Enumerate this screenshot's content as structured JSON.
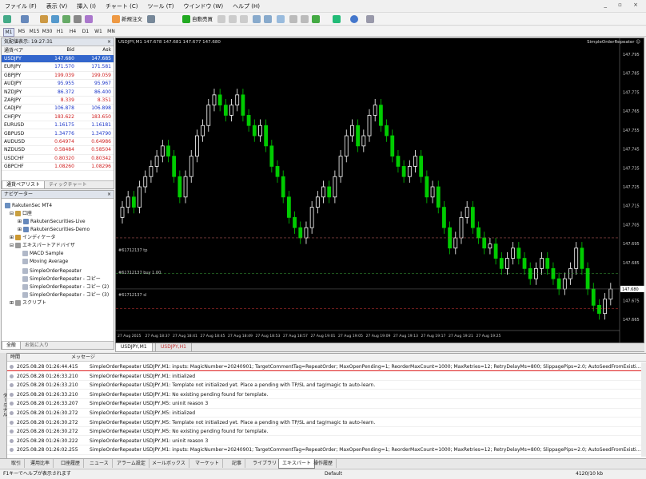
{
  "menu": [
    "ファイル (F)",
    "表示 (V)",
    "挿入 (I)",
    "チャート (C)",
    "ツール (T)",
    "ウインドウ (W)",
    "ヘルプ (H)"
  ],
  "toolbar": {
    "new_order": "新規注文",
    "auto_trade": "自動売買"
  },
  "timeframes": [
    "M1",
    "M5",
    "M15",
    "M30",
    "H1",
    "H4",
    "D1",
    "W1",
    "MN"
  ],
  "market_watch": {
    "title": "気配値表示: 19:27:31",
    "cols": {
      "pair": "通貨ペア",
      "bid": "Bid",
      "ask": "Ask"
    },
    "rows": [
      {
        "pair": "USDJPY",
        "bid": "147.680",
        "ask": "147.685",
        "dir": "sel"
      },
      {
        "pair": "EURJPY",
        "bid": "171.570",
        "ask": "171.581",
        "dir": "up"
      },
      {
        "pair": "GBPJPY",
        "bid": "199.039",
        "ask": "199.059",
        "dir": "dn"
      },
      {
        "pair": "AUDJPY",
        "bid": "95.955",
        "ask": "95.967",
        "dir": "up"
      },
      {
        "pair": "NZDJPY",
        "bid": "86.372",
        "ask": "86.400",
        "dir": "up"
      },
      {
        "pair": "ZARJPY",
        "bid": "8.339",
        "ask": "8.351",
        "dir": "dn"
      },
      {
        "pair": "CADJPY",
        "bid": "106.878",
        "ask": "106.898",
        "dir": "up"
      },
      {
        "pair": "CHFJPY",
        "bid": "183.622",
        "ask": "183.650",
        "dir": "dn"
      },
      {
        "pair": "EURUSD",
        "bid": "1.16175",
        "ask": "1.16181",
        "dir": "up"
      },
      {
        "pair": "GBPUSD",
        "bid": "1.34776",
        "ask": "1.34790",
        "dir": "up"
      },
      {
        "pair": "AUDUSD",
        "bid": "0.64974",
        "ask": "0.64986",
        "dir": "dn"
      },
      {
        "pair": "NZDUSD",
        "bid": "0.58484",
        "ask": "0.58504",
        "dir": "dn"
      },
      {
        "pair": "USDCHF",
        "bid": "0.80320",
        "ask": "0.80342",
        "dir": "dn"
      },
      {
        "pair": "GBPCHF",
        "bid": "1.08260",
        "ask": "1.08296",
        "dir": "dn"
      }
    ],
    "tabs": [
      "通貨ペアリスト",
      "ティックチャート"
    ]
  },
  "navigator": {
    "title": "ナビゲーター",
    "items": [
      "RakutenSec MT4",
      "口座",
      "RakutenSecurities-Live",
      "RakutenSecurities-Demo",
      "インディケータ",
      "エキスパートアドバイザ",
      "MACD Sample",
      "Moving Average",
      "SimpleOrderRepeater",
      "SimpleOrderRepeater - コピー",
      "SimpleOrderRepeater - コピー (2)",
      "SimpleOrderRepeater - コピー (3)",
      "スクリプト"
    ],
    "tabs": [
      "全般",
      "お気に入り"
    ]
  },
  "chart": {
    "header": "USDJPY,M1  147.678 147.681 147.677 147.680",
    "ea_name": "SimpleOrderRepeater ☺",
    "price_labels": [
      "147.795",
      "147.785",
      "147.775",
      "147.765",
      "147.755",
      "147.745",
      "147.735",
      "147.725",
      "147.715",
      "147.705",
      "147.695",
      "147.685",
      "147.680",
      "147.675",
      "147.665"
    ],
    "current_price": "147.680",
    "time_labels": [
      "27 Aug 2025",
      "27 Aug 18:37",
      "27 Aug 18:41",
      "27 Aug 18:45",
      "27 Aug 18:49",
      "27 Aug 18:53",
      "27 Aug 18:57",
      "27 Aug 19:01",
      "27 Aug 19:05",
      "27 Aug 19:09",
      "27 Aug 19:13",
      "27 Aug 19:17",
      "27 Aug 19:21",
      "27 Aug 19:25"
    ],
    "line_tp": "#61712137 tp",
    "line_buy": "#61712137 buy 1.00",
    "line_sl": "#61712137 sl",
    "colors": {
      "bg": "#000000",
      "up": "#ffffff",
      "down": "#00cc00",
      "tp": "#a05050",
      "entry": "#3aa33a",
      "sl": "#cc3333"
    },
    "tabs": [
      "USDJPY,M1",
      "USDJPY,H1"
    ]
  },
  "terminal": {
    "cols": {
      "time": "時間",
      "message": "メッセージ"
    },
    "rows": [
      {
        "time": "2025.08.28 01:26:44.415",
        "msg": "SimpleOrderRepeater USDJPY,M1: inputs: MagicNumber=20240901; TargetCommentTag=RepeatOrder; MaxOpenPending=1; ReorderMaxCount=1000; MaxRetries=12; RetryDelayMs=800; SlippagePips=2.0; AutoSeedFromExisting=t..."
      },
      {
        "time": "2025.08.28 01:26:33.210",
        "msg": "SimpleOrderRepeater USDJPY,M1: initialized"
      },
      {
        "time": "2025.08.28 01:26:33.210",
        "msg": "SimpleOrderRepeater USDJPY,M1: Template not initialized yet. Place a pending with TP/SL and tag/magic to auto-learn."
      },
      {
        "time": "2025.08.28 01:26:33.210",
        "msg": "SimpleOrderRepeater USDJPY,M1: No existing pending found for template."
      },
      {
        "time": "2025.08.28 01:26:33.207",
        "msg": "SimpleOrderRepeater USDJPY,M5: uninit reason 3"
      },
      {
        "time": "2025.08.28 01:26:30.272",
        "msg": "SimpleOrderRepeater USDJPY,M5: initialized"
      },
      {
        "time": "2025.08.28 01:26:30.272",
        "msg": "SimpleOrderRepeater USDJPY,M5: Template not initialized yet. Place a pending with TP/SL and tag/magic to auto-learn."
      },
      {
        "time": "2025.08.28 01:26:30.272",
        "msg": "SimpleOrderRepeater USDJPY,M5: No existing pending found for template."
      },
      {
        "time": "2025.08.28 01:26:30.222",
        "msg": "SimpleOrderRepeater USDJPY,M1: uninit reason 3"
      },
      {
        "time": "2025.08.28 01:26:02.255",
        "msg": "SimpleOrderRepeater USDJPY,M1: inputs: MagicNumber=20240901; TargetCommentTag=RepeatOrder; MaxOpenPending=1; ReorderMaxCount=1000; MaxRetries=12; RetryDelayMs=800; SlippagePips=2.0; AutoSeedFromExisting=t..."
      }
    ],
    "tabs": [
      "取引",
      "運用比率",
      "口座履歴",
      "ニュース",
      "アラーム設定",
      "メールボックス",
      "マーケット",
      "記事",
      "ライブラリ",
      "エキスパート",
      "操作履歴"
    ],
    "side_label": "ターミナル"
  },
  "status": {
    "help": "F1キーでヘルプが表示されます",
    "profile": "Default",
    "traffic": "4120/10 kb"
  }
}
